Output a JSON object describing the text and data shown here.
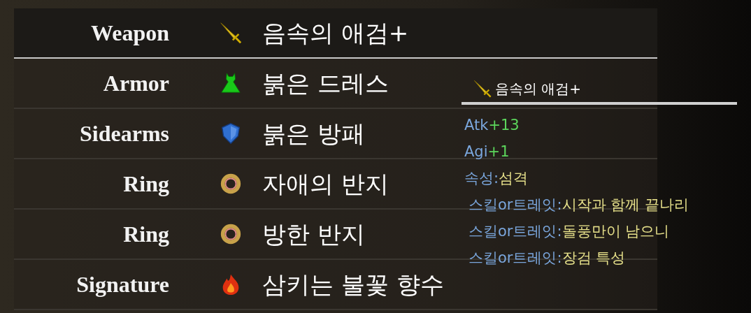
{
  "slots": [
    {
      "label": "Weapon",
      "kind": "sword",
      "item": "음속의 애검+",
      "selected": true
    },
    {
      "label": "Armor",
      "kind": "dress",
      "item": "붉은 드레스",
      "selected": false
    },
    {
      "label": "Sidearms",
      "kind": "shield",
      "item": "붉은 방패",
      "selected": false
    },
    {
      "label": "Ring",
      "kind": "ring",
      "item": "자애의 반지",
      "selected": false
    },
    {
      "label": "Ring",
      "kind": "ring",
      "item": "방한 반지",
      "selected": false
    },
    {
      "label": "Signature",
      "kind": "fire",
      "item": "삼키는 불꽃 향수",
      "selected": false
    }
  ],
  "tooltip": {
    "kind": "sword",
    "title": "음속의 애검+",
    "stats": [
      {
        "key": "Atk",
        "value": "+13",
        "kind": "number"
      },
      {
        "key": "Agi",
        "value": "+1",
        "kind": "number"
      },
      {
        "key": "속성:",
        "value": "섬격",
        "kind": "text"
      },
      {
        "key": "스킬or트레잇:",
        "value": "시작과 함께 끝나리",
        "kind": "text"
      },
      {
        "key": "스킬or트레잇:",
        "value": "돌풍만이 남으니",
        "kind": "text"
      },
      {
        "key": "스킬or트레잇:",
        "value": "장검 특성",
        "kind": "text"
      }
    ]
  }
}
